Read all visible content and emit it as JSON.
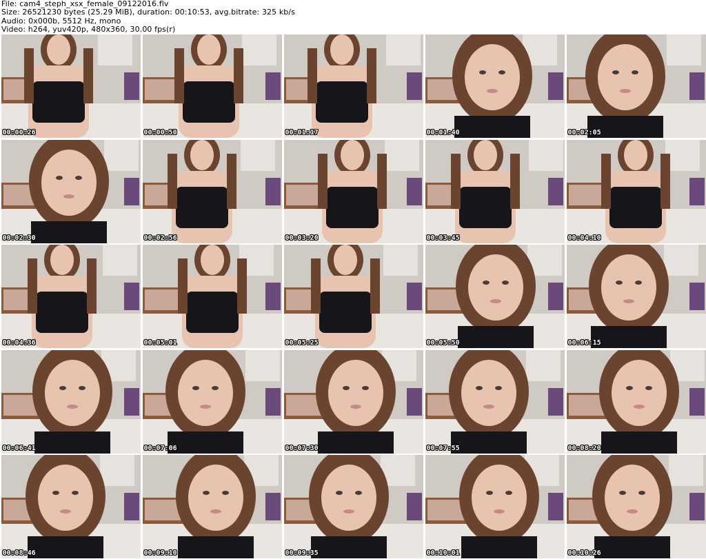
{
  "header": {
    "file_line": "File: cam4_steph_xsx_female_09122016.flv",
    "size_line": "Size: 26521230 bytes (25.29 MiB), duration: 00:10:53, avg.bitrate: 325 kb/s",
    "audio_line": "Audio: 0x000b, 5512 Hz, mono",
    "video_line": "Video: h264, yuv420p, 480x360, 30.00 fps(r)"
  },
  "thumbnails": [
    {
      "timestamp": "00:00:26"
    },
    {
      "timestamp": "00:00:50"
    },
    {
      "timestamp": "00:01:17"
    },
    {
      "timestamp": "00:01:40"
    },
    {
      "timestamp": "00:02:05"
    },
    {
      "timestamp": "00:02:30"
    },
    {
      "timestamp": "00:02:56"
    },
    {
      "timestamp": "00:03:20"
    },
    {
      "timestamp": "00:03:45"
    },
    {
      "timestamp": "00:04:10"
    },
    {
      "timestamp": "00:04:36"
    },
    {
      "timestamp": "00:05:01"
    },
    {
      "timestamp": "00:05:25"
    },
    {
      "timestamp": "00:05:50"
    },
    {
      "timestamp": "00:06:15"
    },
    {
      "timestamp": "00:06:41"
    },
    {
      "timestamp": "00:07:06"
    },
    {
      "timestamp": "00:07:30"
    },
    {
      "timestamp": "00:07:55"
    },
    {
      "timestamp": "00:08:20"
    },
    {
      "timestamp": "00:08:46"
    },
    {
      "timestamp": "00:09:10"
    },
    {
      "timestamp": "00:09:35"
    },
    {
      "timestamp": "00:10:01"
    },
    {
      "timestamp": "00:10:26"
    }
  ],
  "colors": {
    "wall": "#cfcac4",
    "skin": "#e8c4b0",
    "hair": "#6b4430",
    "top": "#15151a",
    "furniture": "#8a5a3a",
    "bedding": "#e9e6e2"
  }
}
